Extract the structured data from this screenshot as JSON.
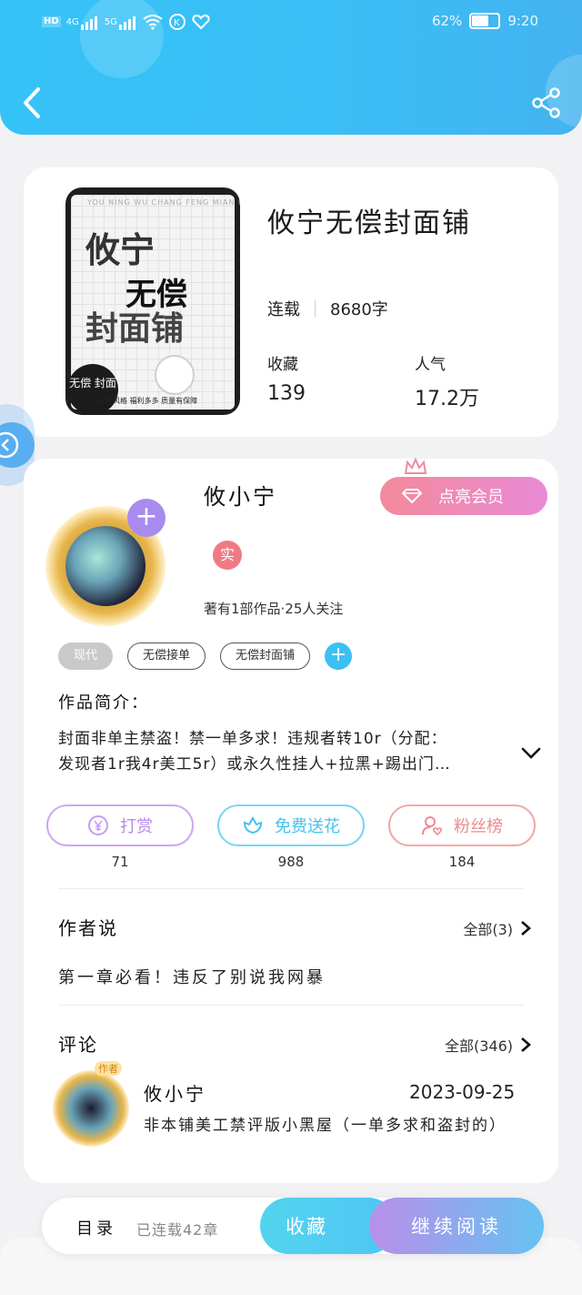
{
  "status_bar": {
    "left_icons": [
      "hd-icon",
      "signal-4g-icon",
      "signal-5g-icon",
      "wifi-icon",
      "k-icon",
      "heart-link-icon"
    ],
    "net1": "4G",
    "net2": "5G",
    "battery": "62%",
    "time": "9:20"
  },
  "header": {
    "back_icon": "chevron-left-icon",
    "share_icon": "share-icon"
  },
  "book": {
    "title": "攸宁无偿封面铺",
    "status": "连载",
    "word_count": "8680字",
    "collect_label": "收藏",
    "collect_value": "139",
    "popularity_label": "人气",
    "popularity_value": "17.2万",
    "cover": {
      "pinyin": "YOU NING WU CHANG FENG MIAN PU",
      "line1": "攸宁",
      "line2": "无偿",
      "line3": "封面铺",
      "badge": "无偿 封面",
      "footer": "各种风格  福利多多  质量有保障"
    }
  },
  "author": {
    "name": "攸小宁",
    "badge": "实",
    "meta": "著有1部作品·25人关注",
    "plus": "+",
    "vip_button": "点亮会员"
  },
  "tags": [
    "现代",
    "无偿接单",
    "无偿封面铺"
  ],
  "tag_add": "+",
  "intro": {
    "title": "作品简介：",
    "line1": "封面非单主禁盗！禁一单多求！违规者转10r（分配：",
    "line2": "发现者1r我4r美工5r）或永久性挂人+拉黑+踢出门…"
  },
  "actions": {
    "tip_label": "打赏",
    "tip_count": "71",
    "flower_label": "免费送花",
    "flower_count": "988",
    "fans_label": "粉丝榜",
    "fans_count": "184"
  },
  "author_say": {
    "title": "作者说",
    "all_link": "全部(3)",
    "content": "第一章必看！违反了别说我网暴"
  },
  "comments": {
    "title": "评论",
    "all_link": "全部(346)",
    "items": [
      {
        "badge": "作者",
        "name": "攸小宁",
        "date": "2023-09-25",
        "text": "非本铺美工禁评版小黑屋（一单多求和盗封的）"
      }
    ]
  },
  "bottom_bar": {
    "toc": "目录",
    "toc_count": "已连载42章",
    "collect": "收藏",
    "continue": "继续阅读"
  },
  "colors": {
    "header": "#39bff5",
    "vip": "#f38a9a",
    "accent_blue": "#3cc0f3",
    "purple": "#a98bf0"
  }
}
